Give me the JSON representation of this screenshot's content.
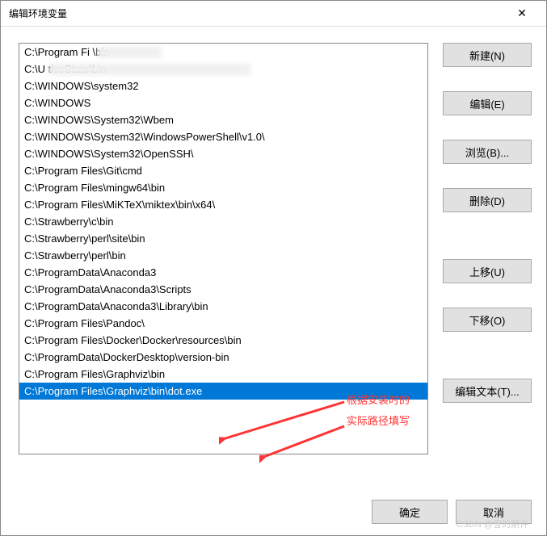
{
  "title": "编辑环境变量",
  "items": [
    "C:\\Program Fi             \\bin",
    "C:\\U                                               tiveState\\bin",
    "C:\\WINDOWS\\system32",
    "C:\\WINDOWS",
    "C:\\WINDOWS\\System32\\Wbem",
    "C:\\WINDOWS\\System32\\WindowsPowerShell\\v1.0\\",
    "C:\\WINDOWS\\System32\\OpenSSH\\",
    "C:\\Program Files\\Git\\cmd",
    "C:\\Program Files\\mingw64\\bin",
    "C:\\Program Files\\MiKTeX\\miktex\\bin\\x64\\",
    "C:\\Strawberry\\c\\bin",
    "C:\\Strawberry\\perl\\site\\bin",
    "C:\\Strawberry\\perl\\bin",
    "C:\\ProgramData\\Anaconda3",
    "C:\\ProgramData\\Anaconda3\\Scripts",
    "C:\\ProgramData\\Anaconda3\\Library\\bin",
    "C:\\Program Files\\Pandoc\\",
    "C:\\Program Files\\Docker\\Docker\\resources\\bin",
    "C:\\ProgramData\\DockerDesktop\\version-bin",
    "C:\\Program Files\\Graphviz\\bin",
    "C:\\Program Files\\Graphviz\\bin\\dot.exe"
  ],
  "selected_index": 20,
  "buttons": {
    "new": "新建(N)",
    "edit": "编辑(E)",
    "browse": "浏览(B)...",
    "delete": "删除(D)",
    "moveup": "上移(U)",
    "movedown": "下移(O)",
    "edittext": "编辑文本(T)..."
  },
  "footer": {
    "ok": "确定",
    "cancel": "取消"
  },
  "annotation": {
    "line1": "根据安装时的",
    "line2": "实际路径填写"
  },
  "watermark": "CSDN @雪的期许"
}
